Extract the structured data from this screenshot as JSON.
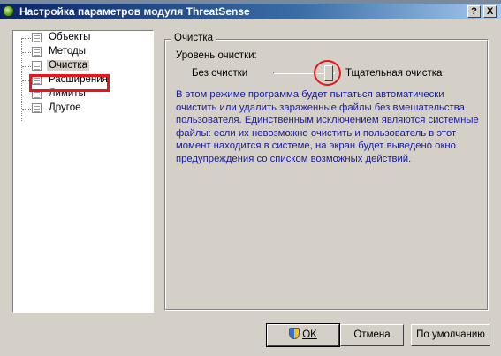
{
  "window": {
    "title": "Настройка параметров модуля ThreatSense",
    "help_label": "?",
    "close_label": "X"
  },
  "tree": {
    "items": [
      {
        "label": "Объекты",
        "selected": false
      },
      {
        "label": "Методы",
        "selected": false
      },
      {
        "label": "Очистка",
        "selected": true
      },
      {
        "label": "Расширения",
        "selected": false
      },
      {
        "label": "Лимиты",
        "selected": false
      },
      {
        "label": "Другое",
        "selected": false
      }
    ]
  },
  "cleaning": {
    "group_title": "Очистка",
    "level_label": "Уровень очистки:",
    "slider_min_label": "Без очистки",
    "slider_max_label": "Тщательная очистка",
    "slider_position": "max",
    "description": "В этом режиме программа будет пытаться автоматически очистить или удалить зараженные файлы без вмешательства пользователя. Единственным исключением являются системные файлы: если их невозможно очистить и пользователь в этот момент находится в системе, на экран будет выведено окно предупреждения со списком возможных действий."
  },
  "buttons": {
    "ok_label": "OK",
    "cancel_label": "Отмена",
    "default_label": "По умолчанию"
  },
  "annotations": {
    "highlight_color": "#e8141e"
  }
}
